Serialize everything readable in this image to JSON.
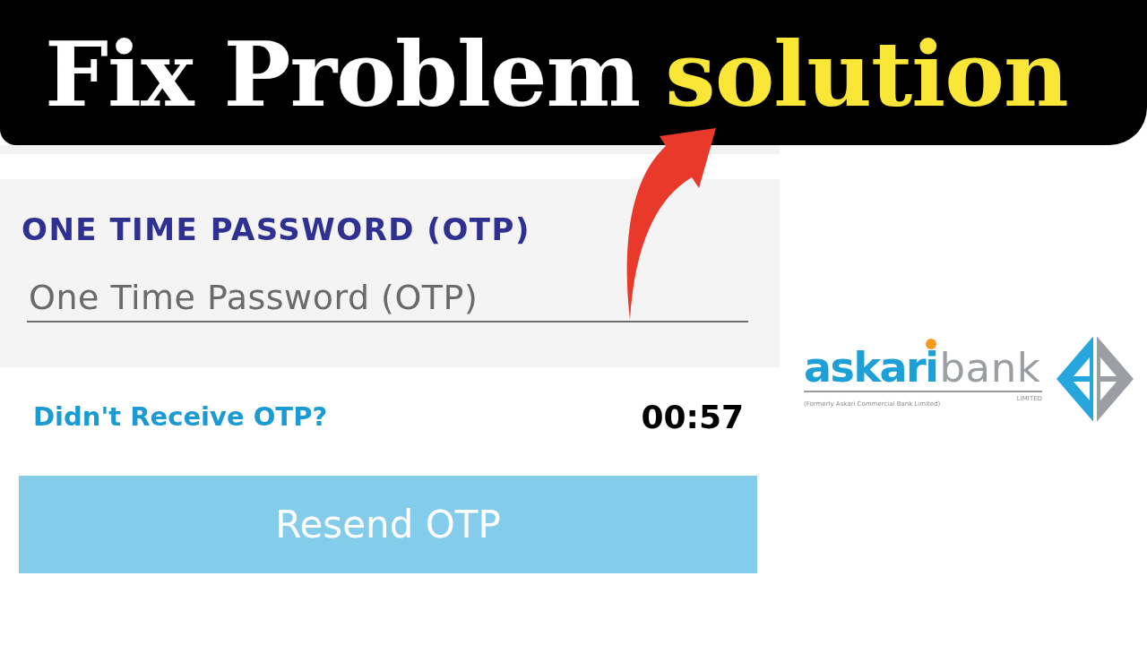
{
  "banner": {
    "title": [
      {
        "text": "Fix Problem",
        "highlight": false
      },
      {
        "text": "solution",
        "highlight": true
      }
    ]
  },
  "otp_form": {
    "label": "ONE TIME PASSWORD (OTP)",
    "otp_field": {
      "placeholder": "One Time Password (OTP)"
    },
    "resend_prompt": "Didn't Receive OTP?",
    "countdown": "00:57",
    "resend_button": {
      "label": "Resend OTP",
      "disabled": true
    }
  },
  "logo": {
    "name_bold": "askari",
    "name_light": "bank",
    "suffix": "LIMITED",
    "tagline": "(Formerly Askari Commercial Bank Limited)"
  }
}
